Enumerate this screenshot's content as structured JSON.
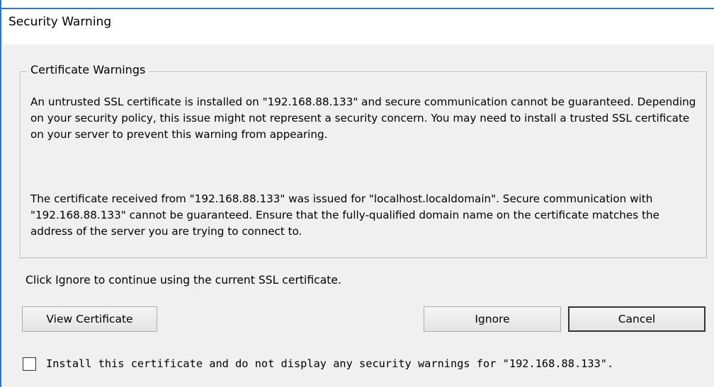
{
  "window": {
    "title": "Security Warning"
  },
  "group": {
    "legend": "Certificate Warnings",
    "paragraph1": "An untrusted SSL certificate is installed on \"192.168.88.133\" and secure communication cannot be guaranteed.  Depending on your security policy, this issue might not represent a security concern.  You may need to install a trusted SSL certificate on your server to prevent this warning from appearing.",
    "paragraph2": "The certificate received from \"192.168.88.133\" was issued for \"localhost.localdomain\".  Secure communication with \"192.168.88.133\" cannot be guaranteed.  Ensure that the fully-qualified domain name on the certificate matches the address of the server you are trying to connect to."
  },
  "hint": "Click Ignore to continue using the current SSL certificate.",
  "buttons": {
    "view_certificate": "View Certificate",
    "ignore": "Ignore",
    "cancel": "Cancel"
  },
  "checkbox": {
    "label": "Install this certificate and do not display any security warnings for \"192.168.88.133\".",
    "checked": false
  },
  "colors": {
    "accent_border": "#2b79c6",
    "dialog_background": "#f0f0f0"
  }
}
